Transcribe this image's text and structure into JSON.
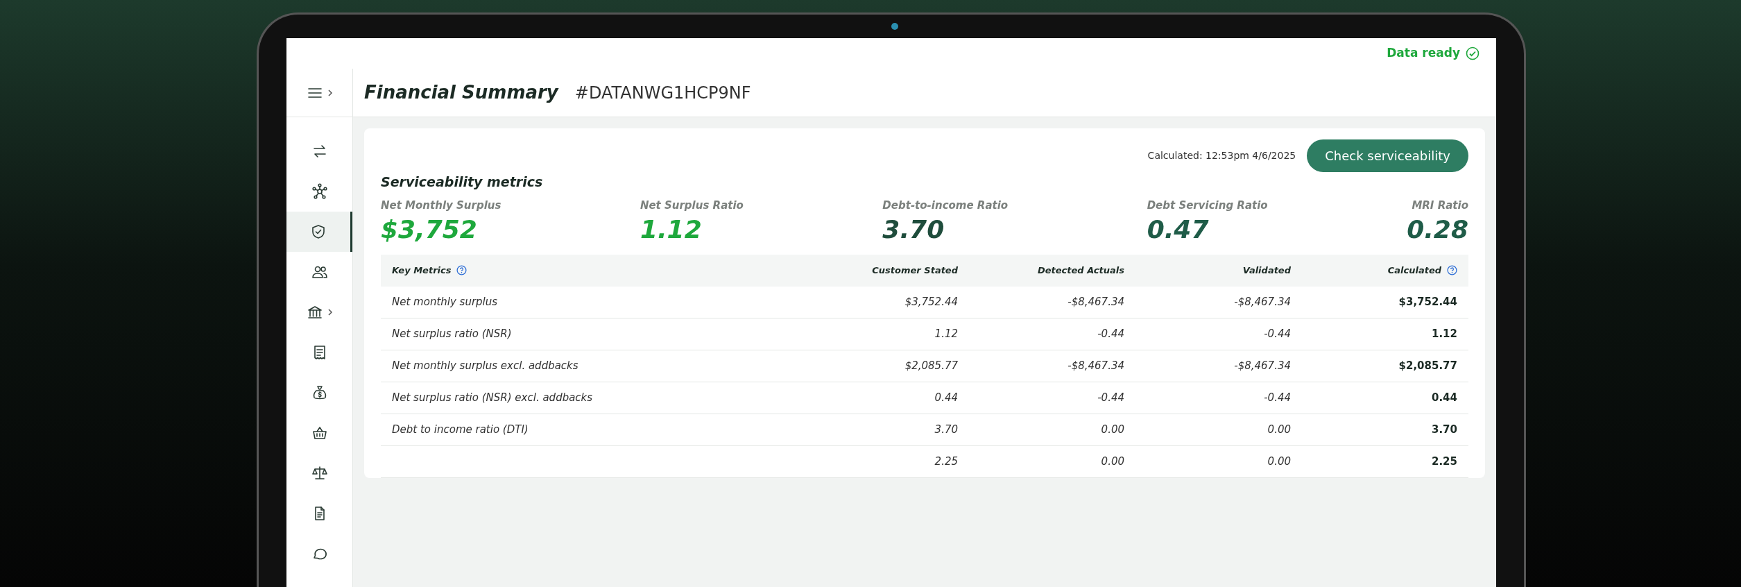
{
  "status": {
    "text": "Data ready"
  },
  "sidebar": {
    "toggle": {
      "submenu": true
    },
    "items": [
      {
        "kind": "swap",
        "selected": false,
        "submenu": false
      },
      {
        "kind": "network",
        "selected": false,
        "submenu": false
      },
      {
        "kind": "shield",
        "selected": true,
        "submenu": false
      },
      {
        "kind": "people",
        "selected": false,
        "submenu": false
      },
      {
        "kind": "bank",
        "selected": false,
        "submenu": true
      },
      {
        "kind": "receipt",
        "selected": false,
        "submenu": false
      },
      {
        "kind": "moneybag",
        "selected": false,
        "submenu": false
      },
      {
        "kind": "basket",
        "selected": false,
        "submenu": false
      },
      {
        "kind": "scales",
        "selected": false,
        "submenu": false
      },
      {
        "kind": "document",
        "selected": false,
        "submenu": false
      },
      {
        "kind": "chat",
        "selected": false,
        "submenu": false
      }
    ]
  },
  "header": {
    "title": "Financial Summary",
    "reference": "#DATANWG1HCP9NF"
  },
  "calculated": "Calculated: 12:53pm 4/6/2025",
  "action_button": "Check serviceability",
  "metrics_panel": {
    "title": "Serviceability metrics",
    "metrics": [
      {
        "label": "Net Monthly Surplus",
        "value": "$3,752",
        "color": "#1ea83c"
      },
      {
        "label": "Net Surplus Ratio",
        "value": "1.12",
        "color": "#1ea83c"
      },
      {
        "label": "Debt-to-income Ratio",
        "value": "3.70",
        "color": "#1f4d3c"
      },
      {
        "label": "Debt Servicing Ratio",
        "value": "0.47",
        "color": "#1f5c48"
      },
      {
        "label": "MRI Ratio",
        "value": "0.28",
        "color": "#1f5c48"
      }
    ]
  },
  "table": {
    "columns": [
      {
        "label": "Key Metrics",
        "help": true
      },
      {
        "label": "Customer Stated",
        "help": false
      },
      {
        "label": "Detected Actuals",
        "help": false
      },
      {
        "label": "Validated",
        "help": false
      },
      {
        "label": "Calculated",
        "help": true
      }
    ],
    "rows": [
      {
        "cells": [
          "Net monthly surplus",
          "$3,752.44",
          "-$8,467.34",
          "-$8,467.34",
          "$3,752.44"
        ]
      },
      {
        "cells": [
          "Net surplus ratio (NSR)",
          "1.12",
          "-0.44",
          "-0.44",
          "1.12"
        ]
      },
      {
        "cells": [
          "Net monthly surplus excl. addbacks",
          "$2,085.77",
          "-$8,467.34",
          "-$8,467.34",
          "$2,085.77"
        ]
      },
      {
        "cells": [
          "Net surplus ratio (NSR) excl. addbacks",
          "0.44",
          "-0.44",
          "-0.44",
          "0.44"
        ]
      },
      {
        "cells": [
          "Debt to income ratio (DTI)",
          "3.70",
          "0.00",
          "0.00",
          "3.70"
        ]
      },
      {
        "cells": [
          "",
          "2.25",
          "0.00",
          "0.00",
          "2.25"
        ]
      }
    ]
  }
}
